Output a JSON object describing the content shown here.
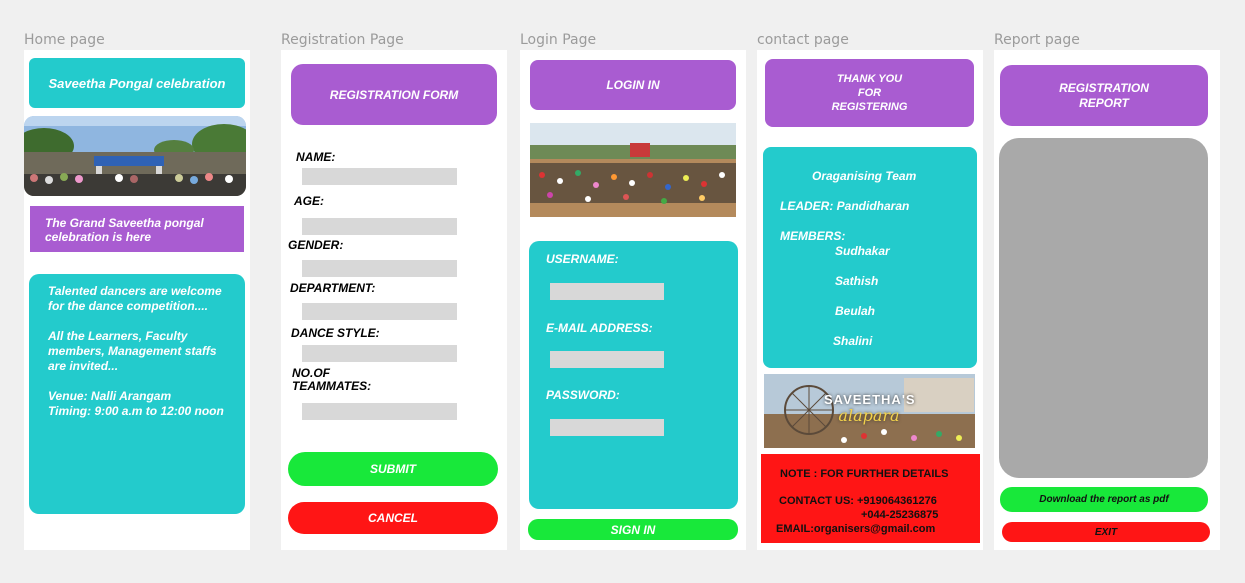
{
  "labels": {
    "home": "Home page",
    "registration": "Registration Page",
    "login": "Login Page",
    "contact": "contact page",
    "report": "Report page"
  },
  "home": {
    "title": "Saveetha Pongal celebration",
    "banner": "The Grand Saveetha pongal celebration is here",
    "info": "Talented dancers are welcome for the dance competition....\n\nAll the Learners, Faculty members, Management staffs are invited...\n\nVenue: Nalli Arangam\nTiming: 9:00 a.m to 12:00 noon"
  },
  "registration": {
    "title": "REGISTRATION FORM",
    "fields": [
      "NAME:",
      "AGE:",
      "GENDER:",
      "DEPARTMENT:",
      "DANCE STYLE:",
      "NO.OF\nTEAMMATES:"
    ],
    "submit": "SUBMIT",
    "cancel": "CANCEL"
  },
  "login": {
    "title": "LOGIN IN",
    "username": "USERNAME:",
    "email": "E-MAIL ADDRESS:",
    "password": "PASSWORD:",
    "sign_in": "SIGN IN"
  },
  "contact": {
    "thanks": "THANK YOU\nFOR\nREGISTERING",
    "team_heading": "Oraganising Team",
    "leader": "LEADER: Pandidharan",
    "members_label": "MEMBERS:",
    "members": [
      "Sudhakar",
      "Sathish",
      "Beulah",
      "Shalini"
    ],
    "brand_top": "SAVEETHA'S",
    "brand_bottom": "alapara",
    "note": "NOTE :  FOR FURTHER DETAILS",
    "contact_line1": "CONTACT US: +919064361276",
    "contact_line2": "+044-25236875",
    "email": "EMAIL:organisers@gmail.com"
  },
  "report": {
    "title": "REGISTRATION\nREPORT",
    "download": "Download the report as pdf",
    "exit": "EXIT"
  },
  "colors": {
    "purple": "#a95cd1",
    "teal": "#23cbcc",
    "green": "#18e83a",
    "red": "#ff1515",
    "gray": "#a9a9a9"
  }
}
